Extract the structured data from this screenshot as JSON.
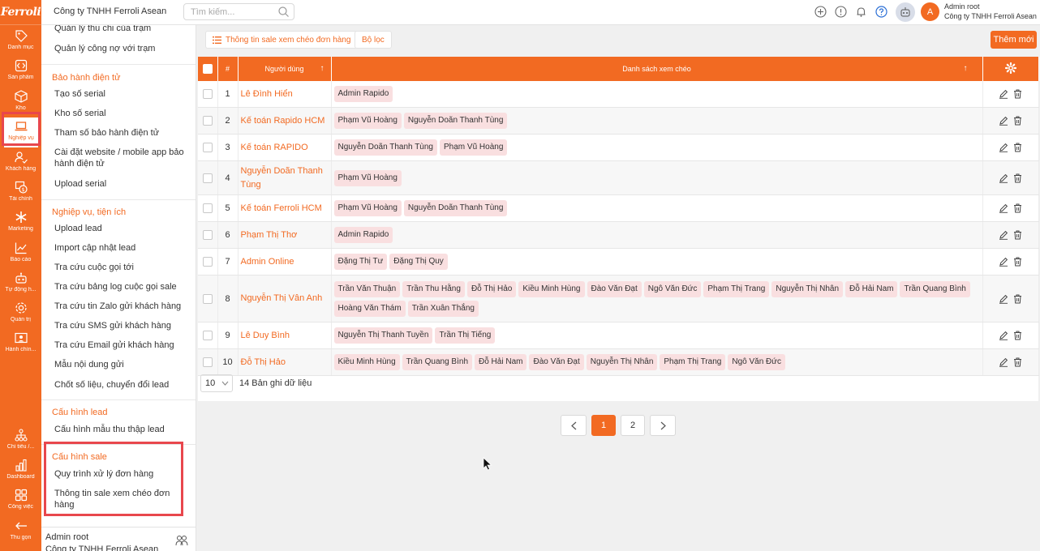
{
  "colors": {
    "accent": "#f26a22",
    "highlight_box": "#e8474d",
    "tag_bg": "#f9dfe0"
  },
  "brand": {
    "logo_text": "Ferroli"
  },
  "rail": [
    {
      "label": "Danh mục",
      "icon": "tag-icon"
    },
    {
      "label": "Sản phẩm",
      "icon": "code-box-icon"
    },
    {
      "label": "Kho",
      "icon": "box-icon"
    },
    {
      "label": "Nghiệp vụ",
      "icon": "laptop-icon",
      "active": true
    },
    {
      "label": "Khách hàng",
      "icon": "users-check-icon"
    },
    {
      "label": "Tài chính",
      "icon": "finance-icon"
    },
    {
      "label": "Marketing",
      "icon": "asterisk-icon"
    },
    {
      "label": "Báo cáo",
      "icon": "chart-line-icon"
    },
    {
      "label": "Tự động h...",
      "icon": "robot-icon"
    },
    {
      "label": "Quản trị",
      "icon": "gear-icon"
    },
    {
      "label": "Hành chín...",
      "icon": "id-card-icon"
    },
    {
      "label": "Chỉ tiêu /...",
      "icon": "org-chart-icon"
    },
    {
      "label": "Dashboard",
      "icon": "bar-chart-icon"
    },
    {
      "label": "Công việc",
      "icon": "grid-icon"
    },
    {
      "label": "Thu gọn",
      "icon": "arrow-left-icon"
    }
  ],
  "header": {
    "company": "Công ty TNHH Ferroli Asean",
    "search_placeholder": "Tìm kiếm...",
    "user_name": "Admin root",
    "user_company": "Công ty TNHH Ferroli Asean",
    "avatar_letter": "A"
  },
  "sidebar": {
    "top_items": [
      "Quản lý thu chi của trạm",
      "Quản lý công nợ với trạm"
    ],
    "warranty_heading": "Bảo hành điện tử",
    "warranty_items": [
      "Tạo số serial",
      "Kho số serial",
      "Tham số bảo hành điện tử",
      "Cài đặt website / mobile app bảo hành điện tử",
      "Upload serial"
    ],
    "ops_heading": "Nghiệp vụ, tiện ích",
    "ops_items": [
      "Upload lead",
      "Import cập nhật lead",
      "Tra cứu cuộc gọi tới",
      "Tra cứu bảng log cuộc gọi sale",
      "Tra cứu tin Zalo gửi khách hàng",
      "Tra cứu SMS gửi khách hàng",
      "Tra cứu Email gửi khách hàng",
      "Mẫu nội dung gửi",
      "Chốt số liệu, chuyển đổi lead"
    ],
    "lead_heading": "Cấu hình lead",
    "lead_items": [
      "Cấu hình mẫu thu thập lead"
    ],
    "sale_heading": "Cấu hình sale",
    "sale_items": [
      "Quy trình xử lý đơn hàng",
      "Thông tin sale xem chéo đơn hàng"
    ],
    "footer_name": "Admin root",
    "footer_company": "Công ty TNHH Ferroli Asean"
  },
  "toolbar": {
    "tab_label": "Thông tin sale xem chéo đơn hàng",
    "filter_label": "Bộ lọc",
    "add_label": "Thêm mới"
  },
  "table": {
    "headers": {
      "index": "#",
      "user": "Người dùng",
      "list": "Danh sách xem chéo"
    },
    "rows": [
      {
        "n": "1",
        "user": "Lê Đình Hiển",
        "tags": [
          "Admin Rapido"
        ]
      },
      {
        "n": "2",
        "user": "Kế toán Rapido HCM",
        "tags": [
          "Phạm Vũ Hoàng",
          "Nguyễn Doãn Thanh Tùng"
        ]
      },
      {
        "n": "3",
        "user": "Kế toán RAPIDO",
        "tags": [
          "Nguyễn Doãn Thanh Tùng",
          "Phạm Vũ Hoàng"
        ]
      },
      {
        "n": "4",
        "user": "Nguyễn Doãn Thanh Tùng",
        "tags": [
          "Phạm Vũ Hoàng"
        ]
      },
      {
        "n": "5",
        "user": "Kế toán Ferroli HCM",
        "tags": [
          "Phạm Vũ Hoàng",
          "Nguyễn Doãn Thanh Tùng"
        ]
      },
      {
        "n": "6",
        "user": "Phạm Thị Thơ",
        "tags": [
          "Admin Rapido"
        ]
      },
      {
        "n": "7",
        "user": "Admin Online",
        "tags": [
          "Đặng Thị Tư",
          "Đặng Thị Quy"
        ]
      },
      {
        "n": "8",
        "user": "Nguyễn Thị Vân Anh",
        "tags": [
          "Trần Văn Thuận",
          "Trần Thu Hằng",
          "Đỗ Thị Hảo",
          "Kiều Minh Hùng",
          "Đào Văn Đạt",
          "Ngô Văn Đức",
          "Phạm Thị Trang",
          "Nguyễn Thị Nhân",
          "Đỗ Hải Nam",
          "Trần Quang Bình",
          "Hoàng Văn Thám",
          "Trần Xuân Thắng"
        ]
      },
      {
        "n": "9",
        "user": "Lê Duy Bình",
        "tags": [
          "Nguyễn Thị Thanh Tuyền",
          "Trần Thị Tiếng"
        ]
      },
      {
        "n": "10",
        "user": "Đỗ Thị Hảo",
        "tags": [
          "Kiều Minh Hùng",
          "Trần Quang Bình",
          "Đỗ Hải Nam",
          "Đào Văn Đạt",
          "Nguyễn Thị Nhân",
          "Phạm Thị Trang",
          "Ngô Văn Đức"
        ]
      }
    ]
  },
  "pager": {
    "page_size": "10",
    "record_count": "14 Bản ghi dữ liệu",
    "pages": [
      "1",
      "2"
    ],
    "current_page": "1"
  }
}
